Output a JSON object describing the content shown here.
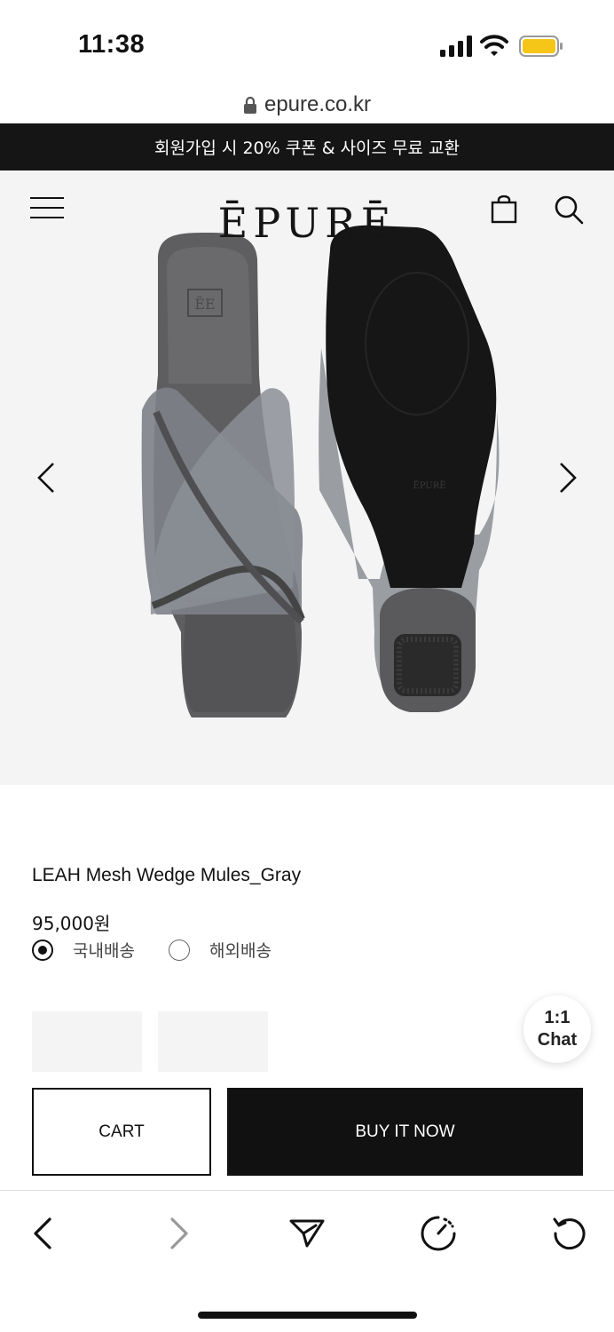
{
  "status_bar": {
    "time": "11:38"
  },
  "browser": {
    "url": "epure.co.kr"
  },
  "promo_banner": {
    "text": "회원가입 시 20% 쿠폰 & 사이즈 무료 교환"
  },
  "header": {
    "logo_text": "ĒPURĒ"
  },
  "product": {
    "title": "LEAH Mesh Wedge Mules_Gray",
    "price": "95,000원",
    "shipping_options": [
      {
        "label": "국내배송",
        "selected": true
      },
      {
        "label": "해외배송",
        "selected": false
      }
    ]
  },
  "chat": {
    "line1": "1:1",
    "line2": "Chat"
  },
  "actions": {
    "cart_label": "CART",
    "buy_label": "BUY IT NOW"
  },
  "icons": {
    "menu": "hamburger-menu-icon",
    "bag": "shopping-bag-icon",
    "search": "search-icon",
    "prev": "chevron-left-icon",
    "next": "chevron-right-icon",
    "toolbar": [
      "back-icon",
      "forward-icon",
      "share-icon",
      "speed-icon",
      "reload-icon"
    ]
  },
  "colors": {
    "banner_bg": "#151515",
    "hero_bg": "#f4f4f4",
    "accent_battery": "#f5c518"
  }
}
